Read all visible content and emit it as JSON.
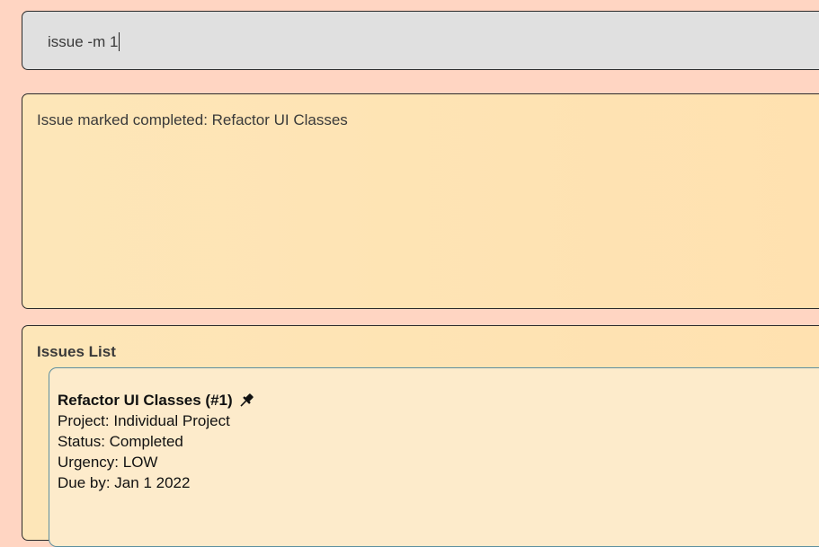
{
  "command": {
    "value": "issue -m 1"
  },
  "result": {
    "message": "Issue marked completed: Refactor UI Classes"
  },
  "issues_list": {
    "title": "Issues List",
    "items": [
      {
        "title": "Refactor UI Classes (#1)",
        "pin_icon": "pin-icon",
        "project": "Project: Individual Project",
        "status": "Status: Completed",
        "urgency": "Urgency: LOW",
        "due": "Due by: Jan 1 2022"
      }
    ]
  }
}
